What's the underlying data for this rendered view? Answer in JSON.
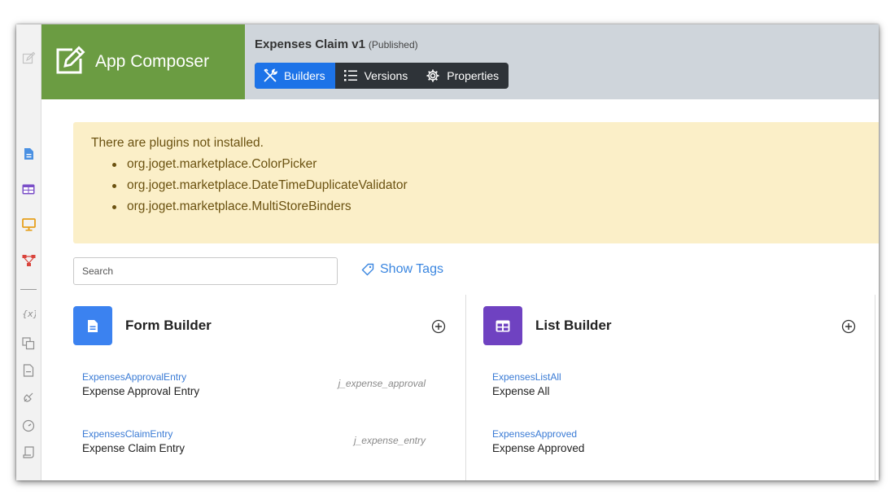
{
  "brand": {
    "title": "App Composer"
  },
  "app": {
    "name": "Expenses Claim v1",
    "status": "(Published)"
  },
  "tabs": [
    {
      "label": "Builders",
      "icon": "tools-icon",
      "active": true
    },
    {
      "label": "Versions",
      "icon": "list-icon",
      "active": false
    },
    {
      "label": "Properties",
      "icon": "gear-icon",
      "active": false
    }
  ],
  "alert": {
    "message": "There are plugins not installed.",
    "plugins": [
      "org.joget.marketplace.ColorPicker",
      "org.joget.marketplace.DateTimeDuplicateValidator",
      "org.joget.marketplace.MultiStoreBinders"
    ]
  },
  "search": {
    "placeholder": "Search"
  },
  "show_tags": {
    "label": "Show Tags"
  },
  "builders": {
    "form": {
      "title": "Form Builder",
      "color": "#3b82f0",
      "items": [
        {
          "id": "ExpensesApprovalEntry",
          "label": "Expense Approval Entry",
          "table": "j_expense_approval"
        },
        {
          "id": "ExpensesClaimEntry",
          "label": "Expense Claim Entry",
          "table": "j_expense_entry"
        }
      ]
    },
    "list": {
      "title": "List Builder",
      "color": "#6f42c1",
      "items": [
        {
          "id": "ExpensesListAll",
          "label": "Expense All"
        },
        {
          "id": "ExpensesApproved",
          "label": "Expense Approved"
        }
      ]
    }
  },
  "colors": {
    "brand": "#6b9c42",
    "accent": "#1d73e8",
    "alert_bg": "#fbefc8",
    "header_bg": "#cfd5db"
  }
}
